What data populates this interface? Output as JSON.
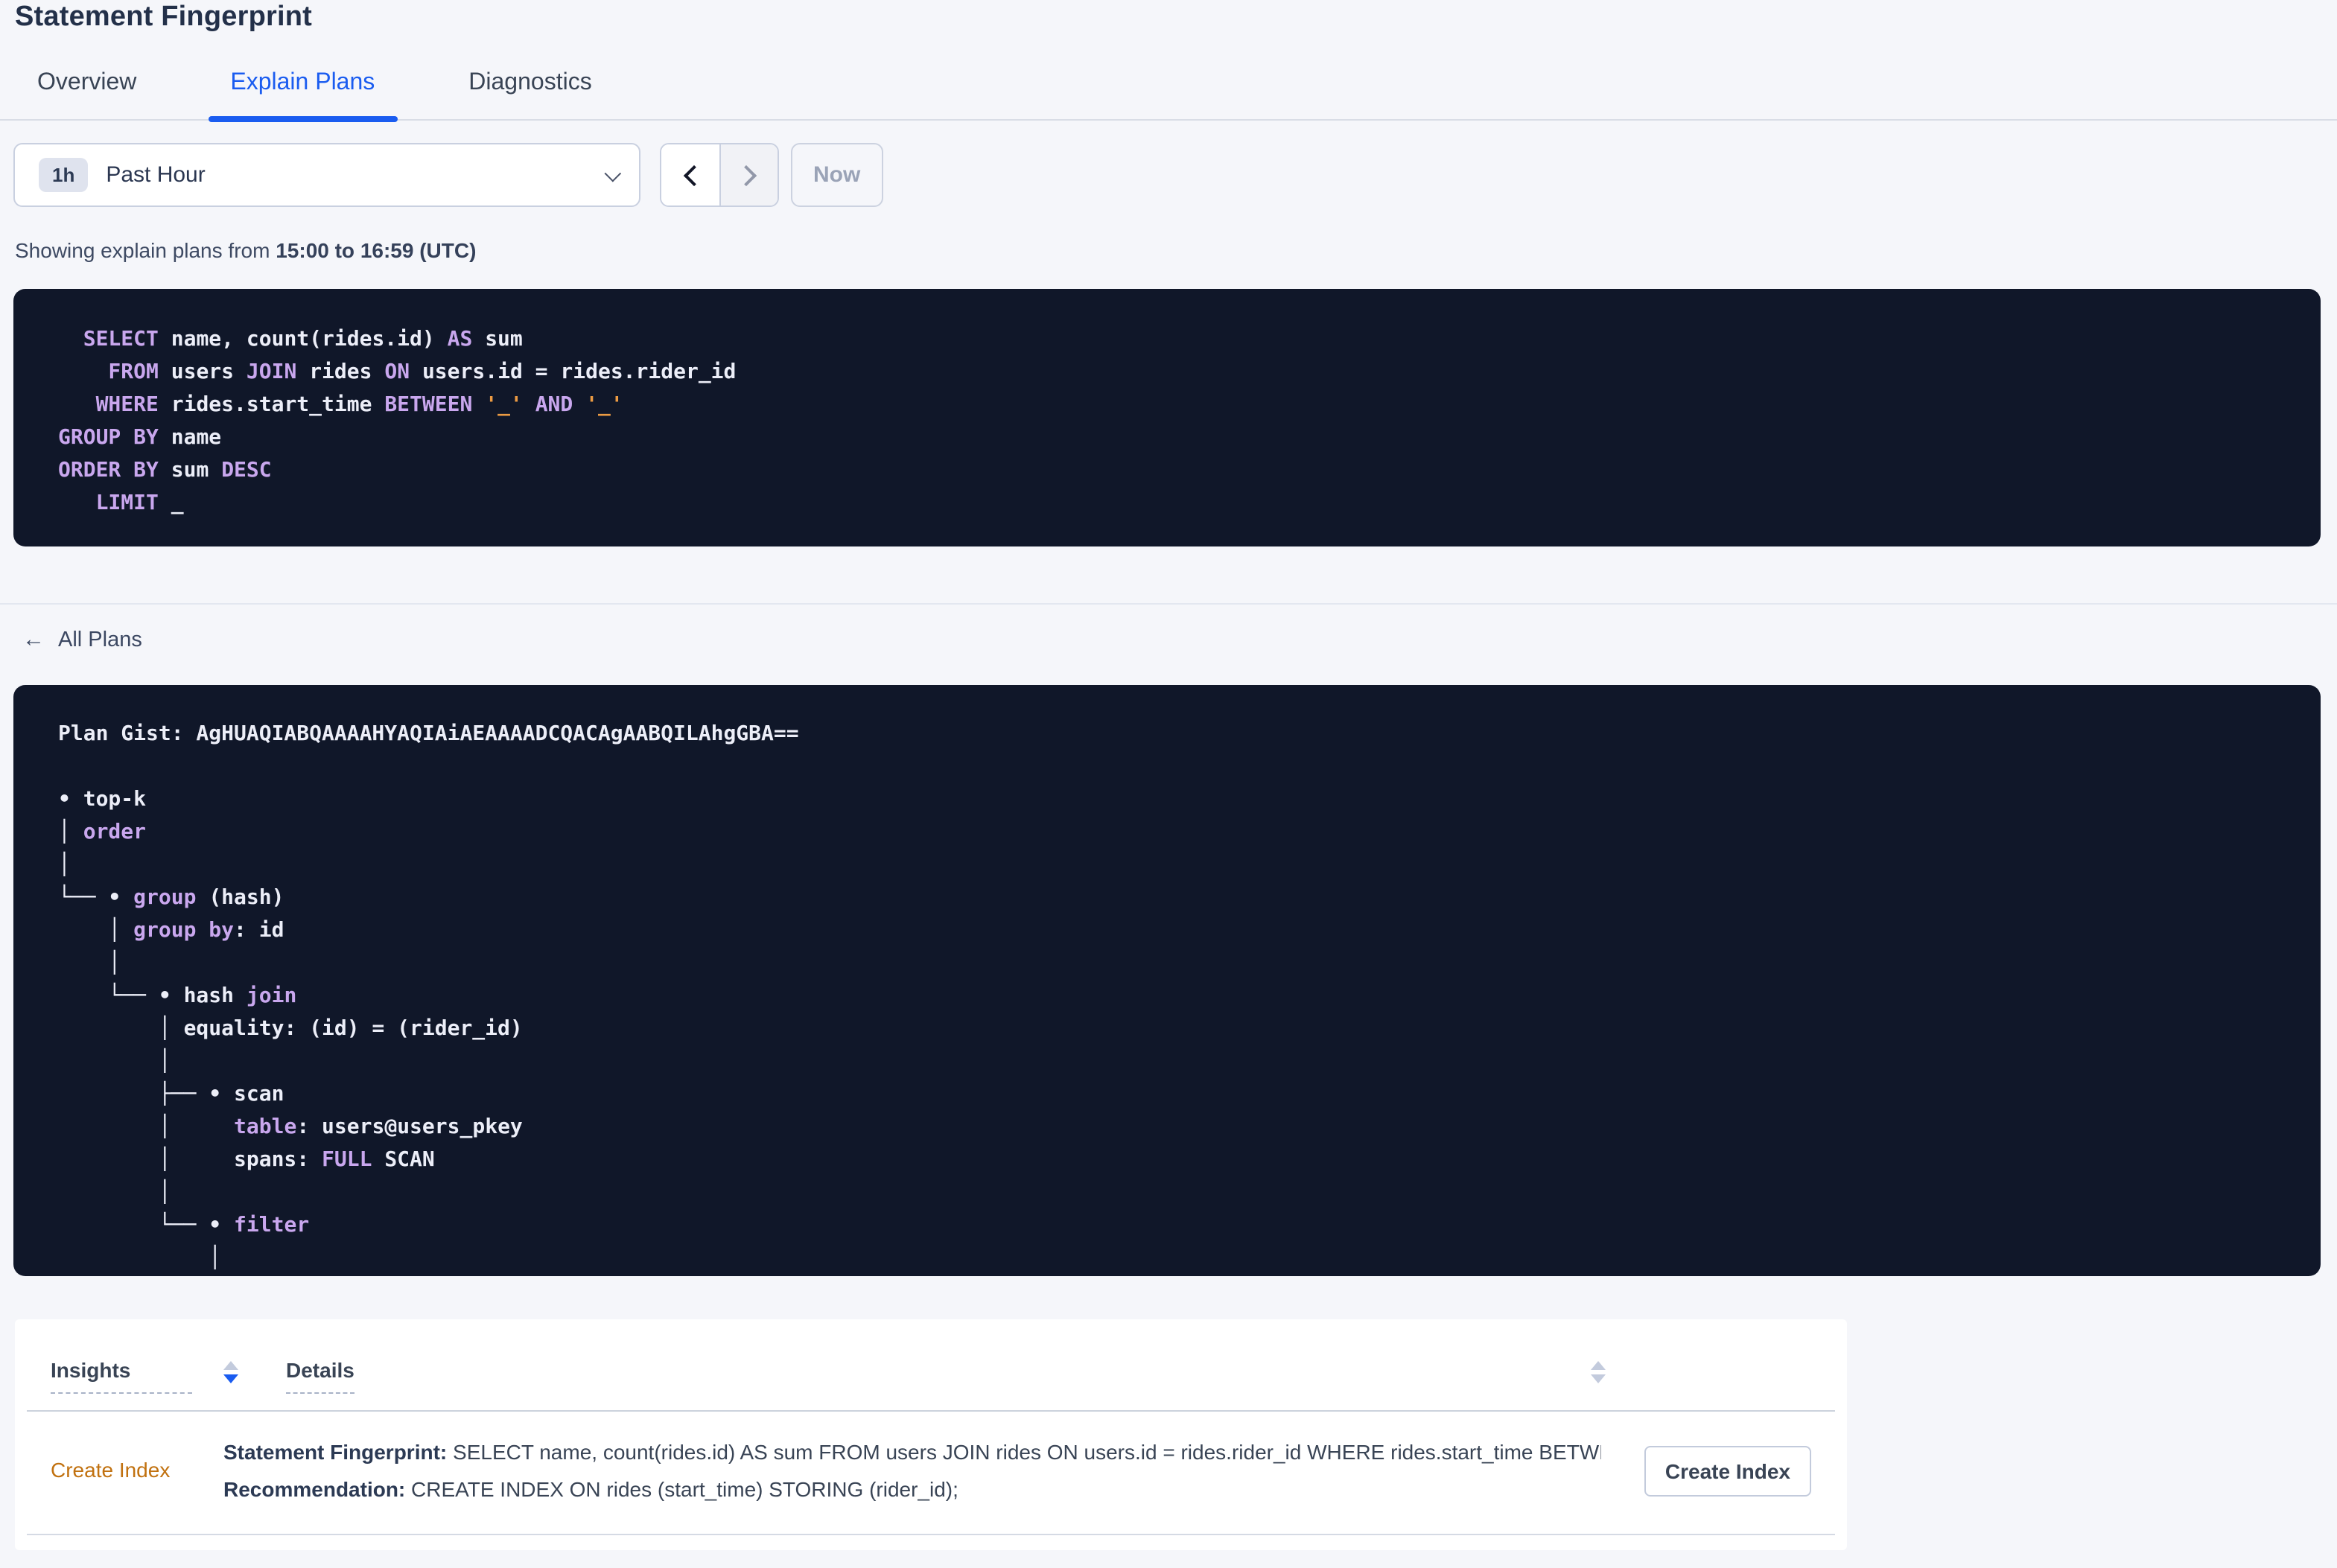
{
  "page": {
    "title": "Statement Fingerprint"
  },
  "tabs": [
    {
      "label": "Overview"
    },
    {
      "label": "Explain Plans"
    },
    {
      "label": "Diagnostics"
    }
  ],
  "active_tab": "Explain Plans",
  "time_controls": {
    "range_badge": "1h",
    "range_label": "Past Hour",
    "now_label": "Now"
  },
  "summary": {
    "prefix": "Showing explain plans from ",
    "bold_range": "15:00 to 16:59 (UTC)"
  },
  "sql_box": {
    "lines": [
      [
        {
          "c": "k",
          "t": "  SELECT"
        },
        {
          "c": "t",
          "t": " name, count(rides.id) "
        },
        {
          "c": "k",
          "t": "AS"
        },
        {
          "c": "t",
          "t": " sum"
        }
      ],
      [
        {
          "c": "k",
          "t": "    FROM"
        },
        {
          "c": "t",
          "t": " users "
        },
        {
          "c": "k",
          "t": "JOIN"
        },
        {
          "c": "t",
          "t": " rides "
        },
        {
          "c": "k",
          "t": "ON"
        },
        {
          "c": "t",
          "t": " users.id = rides.rider_id"
        }
      ],
      [
        {
          "c": "k",
          "t": "   WHERE"
        },
        {
          "c": "t",
          "t": " rides.start_time "
        },
        {
          "c": "k",
          "t": "BETWEEN"
        },
        {
          "c": "t",
          "t": " "
        },
        {
          "c": "s",
          "t": "'_'"
        },
        {
          "c": "t",
          "t": " "
        },
        {
          "c": "k",
          "t": "AND"
        },
        {
          "c": "t",
          "t": " "
        },
        {
          "c": "s",
          "t": "'_'"
        }
      ],
      [
        {
          "c": "k",
          "t": "GROUP BY"
        },
        {
          "c": "t",
          "t": " name"
        }
      ],
      [
        {
          "c": "k",
          "t": "ORDER BY"
        },
        {
          "c": "t",
          "t": " sum "
        },
        {
          "c": "k",
          "t": "DESC"
        }
      ],
      [
        {
          "c": "k",
          "t": "   LIMIT"
        },
        {
          "c": "t",
          "t": " _"
        }
      ]
    ]
  },
  "back_link": {
    "arrow": "←",
    "label": "All Plans"
  },
  "plan_box": {
    "lines": [
      [
        {
          "c": "t",
          "t": "Plan Gist: AgHUAQIABQAAAAHYAQIAiAEAAAADCQACAgAABQILAhgGBA=="
        }
      ],
      [
        {
          "c": "t",
          "t": " "
        }
      ],
      [
        {
          "c": "t",
          "t": "• top-k"
        }
      ],
      [
        {
          "c": "t",
          "t": "│ "
        },
        {
          "c": "k",
          "t": "order"
        }
      ],
      [
        {
          "c": "t",
          "t": "│"
        }
      ],
      [
        {
          "c": "t",
          "t": "└── • "
        },
        {
          "c": "k",
          "t": "group"
        },
        {
          "c": "t",
          "t": " (hash)"
        }
      ],
      [
        {
          "c": "t",
          "t": "    │ "
        },
        {
          "c": "k",
          "t": "group by"
        },
        {
          "c": "t",
          "t": ": id"
        }
      ],
      [
        {
          "c": "t",
          "t": "    │"
        }
      ],
      [
        {
          "c": "t",
          "t": "    └── • hash "
        },
        {
          "c": "k",
          "t": "join"
        }
      ],
      [
        {
          "c": "t",
          "t": "        │ equality: (id) = (rider_id)"
        }
      ],
      [
        {
          "c": "t",
          "t": "        │"
        }
      ],
      [
        {
          "c": "t",
          "t": "        ├── • scan"
        }
      ],
      [
        {
          "c": "t",
          "t": "        │     "
        },
        {
          "c": "k",
          "t": "table"
        },
        {
          "c": "t",
          "t": ": users@users_pkey"
        }
      ],
      [
        {
          "c": "t",
          "t": "        │     spans: "
        },
        {
          "c": "k",
          "t": "FULL"
        },
        {
          "c": "t",
          "t": " SCAN"
        }
      ],
      [
        {
          "c": "t",
          "t": "        │"
        }
      ],
      [
        {
          "c": "t",
          "t": "        └── • "
        },
        {
          "c": "k",
          "t": "filter"
        }
      ],
      [
        {
          "c": "t",
          "t": "            │"
        }
      ]
    ]
  },
  "insights_table": {
    "columns": [
      "Insights",
      "Details"
    ],
    "rows": [
      {
        "insight": "Create Index",
        "statement_label": "Statement Fingerprint:",
        "statement": " SELECT name, count(rides.id) AS sum FROM users JOIN rides ON users.id = rides.rider_id WHERE rides.start_time BETWEEN '_…",
        "recommendation_label": "Recommendation:",
        "recommendation": " CREATE INDEX ON rides (start_time) STORING (rider_id);",
        "action_label": "Create Index"
      }
    ]
  },
  "colors": {
    "accent_blue": "#1a5cf0",
    "code_background": "#101729",
    "code_keyword": "#c9a7ee",
    "code_text": "#eceef8",
    "code_string": "#ec9b43",
    "insight_link": "#c1710f",
    "page_background": "#f5f6fa"
  }
}
